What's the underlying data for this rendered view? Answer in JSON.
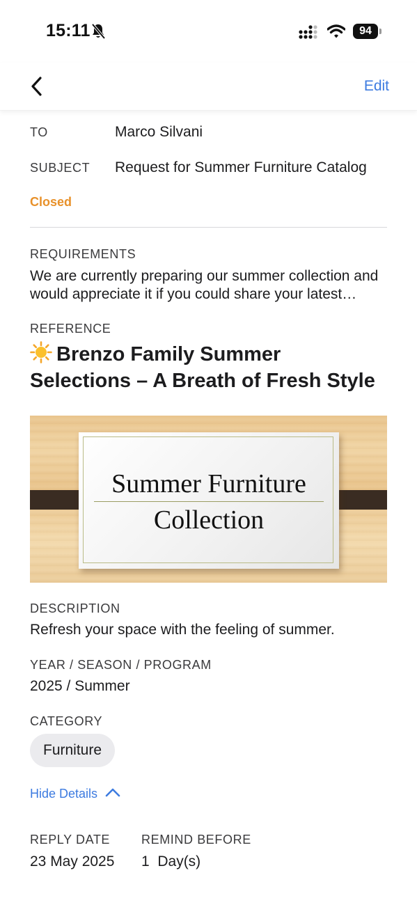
{
  "status_bar": {
    "time": "15:11",
    "battery": "94"
  },
  "nav": {
    "edit_label": "Edit"
  },
  "fields": {
    "to_label": "TO",
    "to_value": "Marco Silvani",
    "subject_label": "SUBJECT",
    "subject_value": "Request for Summer Furniture Catalog",
    "status": "Closed"
  },
  "requirements": {
    "label": "REQUIREMENTS",
    "text": "We are currently preparing our summer collection and would appreciate it if you could share your latest catalog"
  },
  "reference": {
    "label": "REFERENCE",
    "title": "Brenzo Family Summer Selections – A Breath of Fresh Style",
    "image_line_1": "Summer Furniture",
    "image_line_2": "Collection"
  },
  "description": {
    "label": "DESCRIPTION",
    "text": "Refresh your space with the feeling of summer."
  },
  "program": {
    "label": "YEAR / SEASON / PROGRAM",
    "value": "2025 / Summer"
  },
  "category": {
    "label": "CATEGORY",
    "chip": "Furniture"
  },
  "toggle": {
    "hide_details_label": "Hide Details"
  },
  "reply": {
    "reply_date_label": "REPLY DATE",
    "reply_date_value": "23 May 2025",
    "remind_label": "REMIND BEFORE",
    "remind_value": "1  Day(s)"
  },
  "colors": {
    "accent": "#3d7be0",
    "status_closed": "#e8912a"
  }
}
